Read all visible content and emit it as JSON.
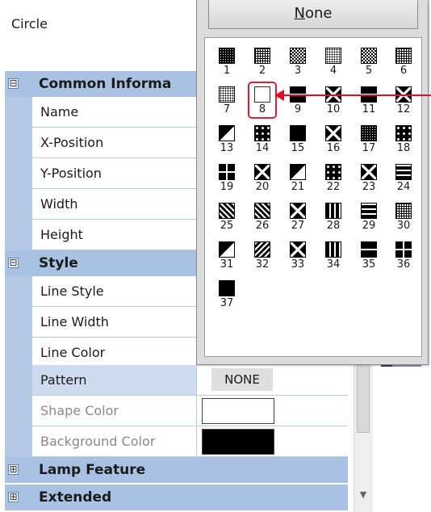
{
  "object": {
    "name": "Circle"
  },
  "categories": {
    "common": {
      "title": "Common Informa",
      "toggle": "⊟"
    },
    "style": {
      "title": "Style",
      "toggle": "⊟"
    },
    "lamp": {
      "title": "Lamp Feature",
      "toggle": "⊞"
    },
    "extended": {
      "title": "Extended",
      "toggle": "⊞"
    }
  },
  "properties": {
    "name": "Name",
    "x_position": "X-Position",
    "y_position": "Y-Position",
    "width": "Width",
    "height": "Height",
    "line_style": "Line Style",
    "line_width": "Line Width",
    "line_color": "Line Color",
    "pattern": "Pattern",
    "shape_color": "Shape Color",
    "background_color": "Background Color"
  },
  "values": {
    "pattern": "NONE",
    "shape_color": "#ffffff",
    "background_color": "#000000"
  },
  "popup": {
    "none_prefix": "",
    "none_underlined": "N",
    "none_rest": "one",
    "selected": "8",
    "patterns": [
      {
        "num": "1",
        "style": "dense"
      },
      {
        "num": "2",
        "style": "grid"
      },
      {
        "num": "3",
        "style": "check"
      },
      {
        "num": "4",
        "style": "dots"
      },
      {
        "num": "5",
        "style": "check"
      },
      {
        "num": "6",
        "style": "grid"
      },
      {
        "num": "7",
        "style": "dots"
      },
      {
        "num": "8",
        "style": "empty"
      },
      {
        "num": "9",
        "style": "split"
      },
      {
        "num": "10",
        "style": "x"
      },
      {
        "num": "11",
        "style": "split"
      },
      {
        "num": "12",
        "style": "x"
      },
      {
        "num": "13",
        "style": "tri"
      },
      {
        "num": "14",
        "style": "patch"
      },
      {
        "num": "15",
        "style": "solid"
      },
      {
        "num": "16",
        "style": "x"
      },
      {
        "num": "17",
        "style": "dense"
      },
      {
        "num": "18",
        "style": "patch"
      },
      {
        "num": "19",
        "style": "cross"
      },
      {
        "num": "20",
        "style": "x"
      },
      {
        "num": "21",
        "style": "tri"
      },
      {
        "num": "22",
        "style": "patch"
      },
      {
        "num": "23",
        "style": "x"
      },
      {
        "num": "24",
        "style": "hbars"
      },
      {
        "num": "25",
        "style": "fdiag"
      },
      {
        "num": "26",
        "style": "fdiag"
      },
      {
        "num": "27",
        "style": "x"
      },
      {
        "num": "28",
        "style": "vbars"
      },
      {
        "num": "29",
        "style": "hbars"
      },
      {
        "num": "30",
        "style": "grid"
      },
      {
        "num": "31",
        "style": "tri"
      },
      {
        "num": "32",
        "style": "bdiag"
      },
      {
        "num": "33",
        "style": "x"
      },
      {
        "num": "34",
        "style": "vbars"
      },
      {
        "num": "35",
        "style": "split"
      },
      {
        "num": "36",
        "style": "cross"
      },
      {
        "num": "37",
        "style": "solid"
      }
    ]
  },
  "colors": {
    "category_bar": "#a9c2e3",
    "highlight": "#e02030"
  }
}
